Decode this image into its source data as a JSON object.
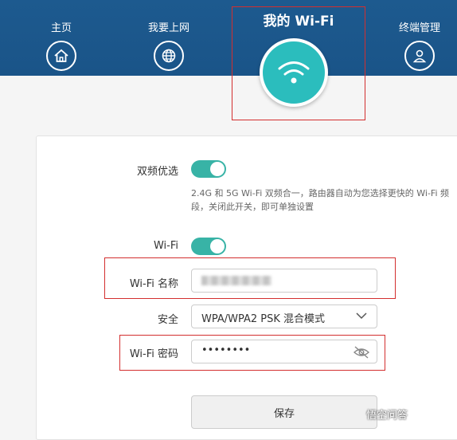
{
  "nav": {
    "home": "主页",
    "internet": "我要上网",
    "mywifi": "我的 Wi-Fi",
    "terminal": "终端管理"
  },
  "settings": {
    "dual_band_label": "双频优选",
    "dual_band_desc": "2.4G 和 5G Wi-Fi 双频合一，路由器自动为您选择更快的 Wi-Fi 频段，关闭此开关，即可单独设置",
    "wifi_label": "Wi-Fi",
    "wifi_name_label": "Wi-Fi 名称",
    "security_label": "安全",
    "security_value": "WPA/WPA2 PSK 混合模式",
    "password_label": "Wi-Fi 密码",
    "password_value": "••••••••",
    "save_label": "保存"
  },
  "toggles": {
    "dual_band_on": true,
    "wifi_on": true
  },
  "colors": {
    "header": "#1d5a8f",
    "accent": "#38b3a6",
    "wifi_circle": "#2bbdbd",
    "highlight_box": "#d32f2f"
  },
  "icons": {
    "home": "home-icon",
    "internet": "globe-icon",
    "mywifi": "wifi-icon",
    "terminal": "user-icon",
    "security_dropdown": "chevron-down-icon",
    "password_visibility": "eye-off-icon"
  },
  "watermark": "悟空问答"
}
